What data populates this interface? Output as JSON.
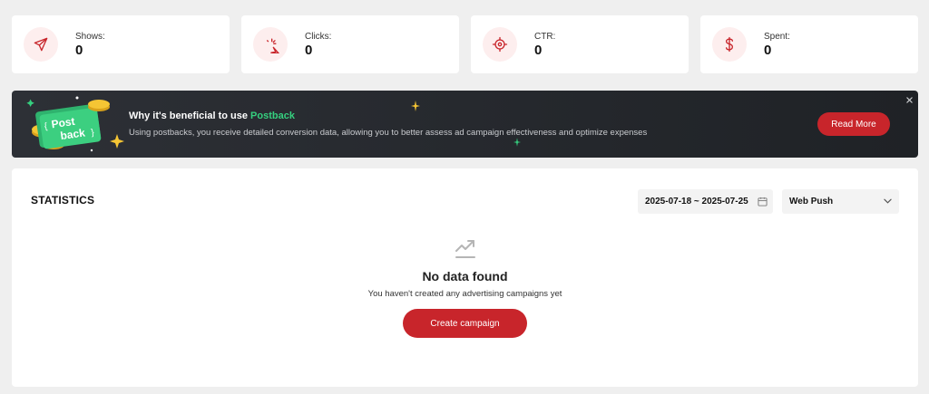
{
  "stats": [
    {
      "label": "Shows:",
      "value": "0",
      "icon": "paper-plane-icon"
    },
    {
      "label": "Clicks:",
      "value": "0",
      "icon": "cursor-click-icon"
    },
    {
      "label": "CTR:",
      "value": "0",
      "icon": "target-icon"
    },
    {
      "label": "Spent:",
      "value": "0",
      "icon": "dollar-icon"
    }
  ],
  "banner": {
    "art_line1": "Post",
    "art_line2": "back",
    "title_prefix": "Why it's beneficial to use ",
    "title_accent": "Postback",
    "description": "Using postbacks, you receive detailed conversion data, allowing you to better assess ad campaign effectiveness and optimize expenses",
    "button_label": "Read More"
  },
  "statistics": {
    "title": "STATISTICS",
    "date_range": "2025-07-18 ~ 2025-07-25",
    "type_selected": "Web Push",
    "empty_title": "No data found",
    "empty_subtitle": "You haven't created any advertising campaigns yet",
    "create_label": "Create campaign"
  },
  "colors": {
    "accent_red": "#c8252b",
    "accent_green": "#35d07f",
    "banner_bg": "#2d3036",
    "page_bg": "#efefef"
  }
}
